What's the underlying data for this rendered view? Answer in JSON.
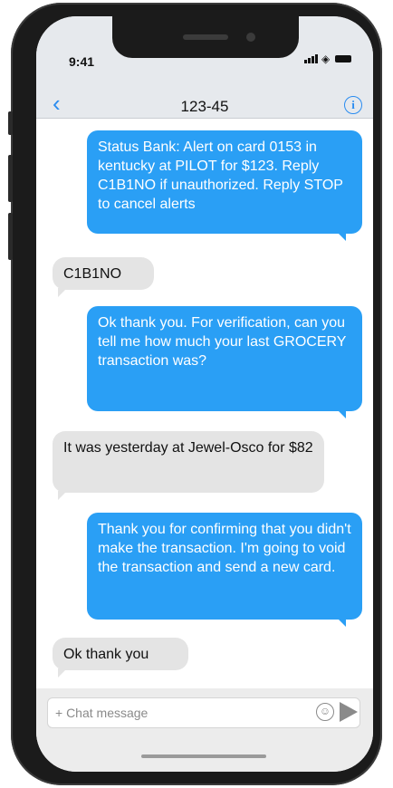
{
  "status_bar": {
    "time": "9:41"
  },
  "header": {
    "back_icon": "chevron-left",
    "title": "123-45",
    "info_icon": "info-circle",
    "accent": "#2a8cf0"
  },
  "messages": [
    {
      "direction": "outgoing",
      "text": "Status Bank: Alert on card 0153 in kentucky at PILOT for $123. Reply C1B1NO if unauthorized. Reply STOP to cancel alerts"
    },
    {
      "direction": "incoming",
      "text": "C1B1NO"
    },
    {
      "direction": "outgoing",
      "text": "Ok thank you. For verification, can you tell me how much your last GROCERY transaction was?"
    },
    {
      "direction": "incoming",
      "text": "It was yesterday at Jewel-Osco for $82"
    },
    {
      "direction": "outgoing",
      "text": "Thank you for confirming that you didn't make the transaction. I'm going to void the transaction and send a new card."
    },
    {
      "direction": "incoming",
      "text": "Ok thank you"
    }
  ],
  "composer": {
    "placeholder": "+ Chat message",
    "emoji_icon": "smiley",
    "send_icon": "paper-plane"
  },
  "colors": {
    "outgoing_bubble": "#2a9ff5",
    "incoming_bubble": "#e4e4e4"
  }
}
